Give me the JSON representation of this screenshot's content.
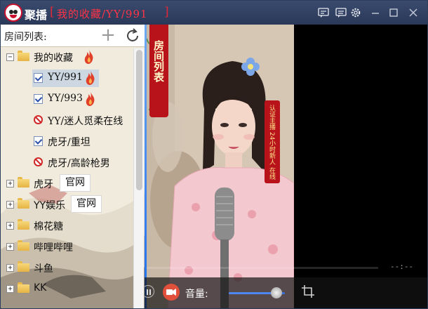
{
  "window": {
    "app_name": "聚播",
    "bracket_left": "[",
    "room_title": "我的收藏/YY/991",
    "bracket_right": "]"
  },
  "titlebar_icons": [
    "chat-icon",
    "chat-icon",
    "gear-icon",
    "minimize-icon",
    "maximize-icon",
    "close-icon"
  ],
  "sidebar": {
    "title": "房间列表:",
    "add_label": "+",
    "tree": [
      {
        "label": "我的收藏",
        "type": "folder",
        "expanded": true,
        "hot": true
      },
      {
        "label": "YY/991",
        "type": "room",
        "status": "checked",
        "hot": true,
        "selected": true
      },
      {
        "label": "YY/993",
        "type": "room",
        "status": "checked",
        "hot": true
      },
      {
        "label": "YY/迷人觅柔在线",
        "type": "room",
        "status": "offline"
      },
      {
        "label": "虎牙/重坦",
        "type": "room",
        "status": "checked"
      },
      {
        "label": "虎牙/高龄枪男",
        "type": "room",
        "status": "offline"
      },
      {
        "label": "虎牙",
        "type": "folder",
        "expanded": false,
        "badge": "官网"
      },
      {
        "label": "YY娱乐",
        "type": "folder",
        "expanded": false,
        "badge": "官网"
      },
      {
        "label": "棉花糖",
        "type": "folder",
        "expanded": false
      },
      {
        "label": "哔哩哔哩",
        "type": "folder",
        "expanded": false
      },
      {
        "label": "斗鱼",
        "type": "folder",
        "expanded": false
      },
      {
        "label": "KK",
        "type": "folder",
        "expanded": false
      }
    ]
  },
  "video": {
    "room_banner": "房间列表",
    "anchor_banner": "认证主播 24小时新人 在线",
    "time_readout": "--:--",
    "volume_label": "音量:",
    "volume_level": 0.85
  },
  "colors": {
    "titlebar": "#2f3e60",
    "accent_red": "#e0283a",
    "accent_blue": "#1a6cf0"
  }
}
